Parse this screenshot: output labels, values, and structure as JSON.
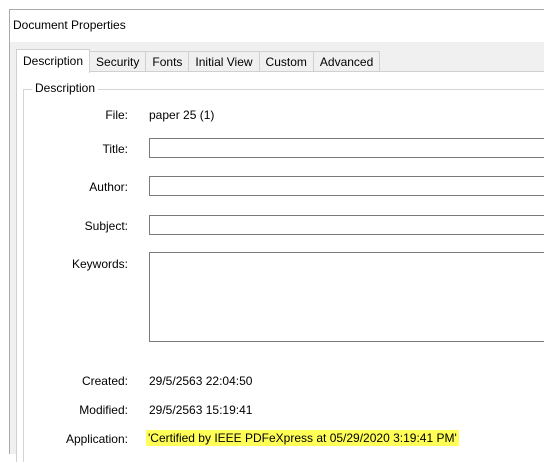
{
  "window": {
    "title": "Document Properties"
  },
  "tabs": [
    {
      "label": "Description",
      "active": true
    },
    {
      "label": "Security"
    },
    {
      "label": "Fonts"
    },
    {
      "label": "Initial View"
    },
    {
      "label": "Custom"
    },
    {
      "label": "Advanced"
    }
  ],
  "description": {
    "group_title": "Description",
    "file": {
      "label": "File:",
      "value": "paper 25 (1)"
    },
    "title": {
      "label": "Title:",
      "value": ""
    },
    "author": {
      "label": "Author:",
      "value": ""
    },
    "subject": {
      "label": "Subject:",
      "value": ""
    },
    "keywords": {
      "label": "Keywords:",
      "value": ""
    },
    "created": {
      "label": "Created:",
      "value": "29/5/2563 22:04:50"
    },
    "modified": {
      "label": "Modified:",
      "value": "29/5/2563 15:19:41"
    },
    "application": {
      "label": "Application:",
      "value": "'Certified by IEEE PDFeXpress at 05/29/2020 3:19:41 PM'"
    }
  },
  "colors": {
    "highlight": "#ffff57"
  }
}
